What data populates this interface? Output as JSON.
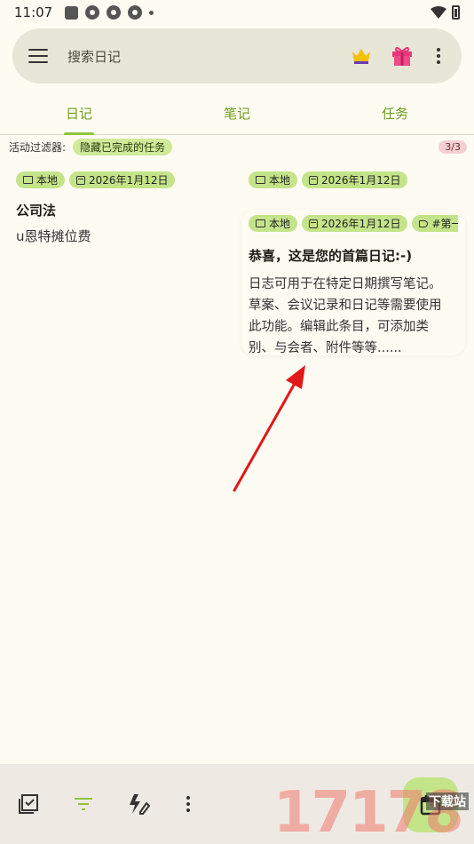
{
  "status_bar": {
    "time": "11:07"
  },
  "search": {
    "placeholder": "搜索日记"
  },
  "tabs": [
    {
      "label": "日记",
      "active": true
    },
    {
      "label": "笔记",
      "active": false
    },
    {
      "label": "任务",
      "active": false
    }
  ],
  "filter": {
    "label": "活动过滤器:",
    "chip": "隐藏已完成的任务",
    "count": "3/3"
  },
  "entry1": {
    "chips": [
      "本地",
      "2026年1月12日"
    ],
    "title": "公司法",
    "body": "u恩特摊位费"
  },
  "entry2_header": {
    "chips": [
      "本地",
      "2026年1月12日"
    ]
  },
  "entry3": {
    "chips": [
      "本地",
      "2026年1月12日",
      "#第一"
    ],
    "title": "恭喜，这是您的首篇日记:-)",
    "body": "日志可用于在特定日期撰写笔记。草案、会议记录和日记等需要使用此功能。编辑此条目，可添加类别、与会者、附件等等......"
  },
  "watermark": {
    "digits": "17178",
    "text": "下载站"
  },
  "colors": {
    "accent": "#8ec43a",
    "chip": "#c4e48a",
    "background": "#fefbf2",
    "arrow": "#e01818"
  }
}
